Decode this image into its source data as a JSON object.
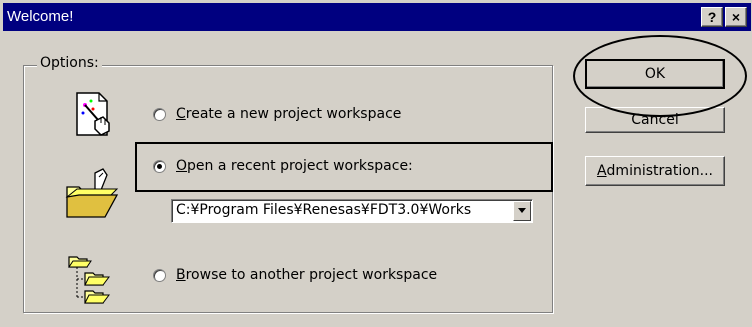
{
  "window": {
    "title": "Welcome!",
    "help_button": "?",
    "close_button": "×"
  },
  "options": {
    "legend": "Options:",
    "create": {
      "label_mnemonic": "C",
      "label_rest": "reate a new project workspace",
      "checked": false
    },
    "open_recent": {
      "label_mnemonic": "O",
      "label_rest": "pen a recent project workspace:",
      "checked": true
    },
    "recent_path": "C:¥Program Files¥Renesas¥FDT3.0¥Works",
    "browse": {
      "label_mnemonic": "B",
      "label_rest": "rowse to another project workspace",
      "checked": false
    }
  },
  "buttons": {
    "ok": "OK",
    "cancel": "Cancel",
    "admin_mnemonic": "A",
    "admin_rest": "dministration..."
  },
  "icons": {
    "create": "new-document-wand-icon",
    "open": "open-folder-icon",
    "browse": "folder-tree-icon",
    "combo_arrow": "chevron-down-icon"
  }
}
